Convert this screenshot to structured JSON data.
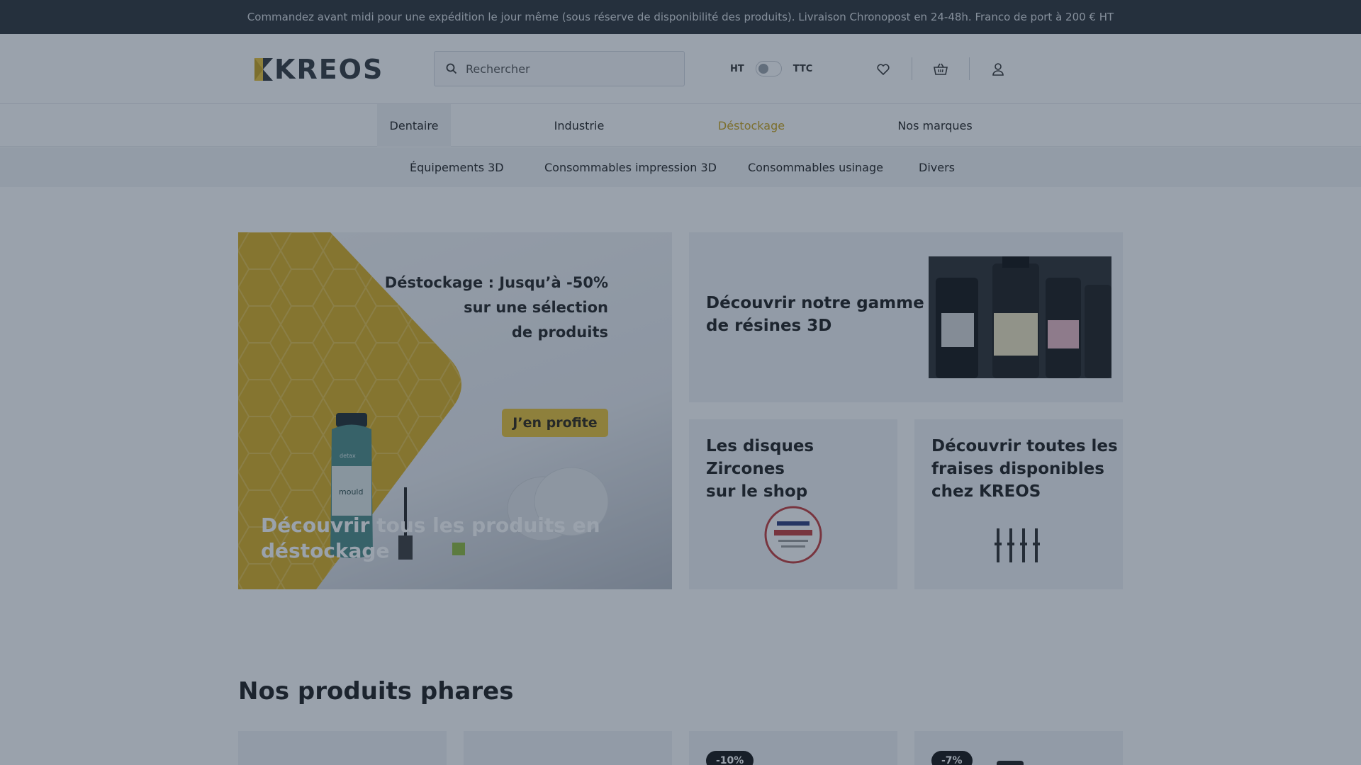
{
  "announcement": "Commandez avant midi pour une expédition le jour même (sous réserve de disponibilité des produits). Livraison Chronopost en 24-48h. Franco de port à 200 € HT",
  "header": {
    "logo_text": "KREOS",
    "search_placeholder": "Rechercher",
    "toggle_left": "HT",
    "toggle_right": "TTC",
    "icons": [
      "heart-icon",
      "basket-icon",
      "user-icon"
    ]
  },
  "nav": {
    "items": [
      {
        "label": "Dentaire"
      },
      {
        "label": "Industrie"
      },
      {
        "label": "Déstockage"
      },
      {
        "label": "Nos marques"
      }
    ],
    "active": "Dentaire",
    "promo_color": "#c9a21a"
  },
  "subnav": {
    "items": [
      {
        "label": "Équipements 3D"
      },
      {
        "label": "Consommables impression 3D"
      },
      {
        "label": "Consommables usinage"
      },
      {
        "label": "Divers"
      }
    ]
  },
  "hero": {
    "headline_line1": "Déstockage : Jusqu’à -50%",
    "headline_line2": "sur une sélection",
    "headline_line3": "de produits",
    "button_label": "J’en profite",
    "caption": "Découvrir tous les produits en déstockage",
    "product_label": "mould",
    "brand_label": "detax"
  },
  "cards": {
    "resins": {
      "title_line1": "Découvrir notre  gamme",
      "title_line2": "de résines 3D"
    },
    "zircones": {
      "title_line1": "Les disques Zircones",
      "title_line2": "sur le shop"
    },
    "fraises": {
      "title_line1": "Découvrir toutes les",
      "title_line2": "fraises disponibles",
      "title_line3": "chez KREOS"
    }
  },
  "section": {
    "title": "Nos produits phares"
  },
  "products": [
    {
      "badge": ""
    },
    {
      "badge": ""
    },
    {
      "badge": "-10%"
    },
    {
      "badge": "-7%"
    }
  ],
  "colors": {
    "accent": "#e9c133",
    "topbar": "#2b3036",
    "overlay": "rgba(30,48,72,0.45)"
  }
}
